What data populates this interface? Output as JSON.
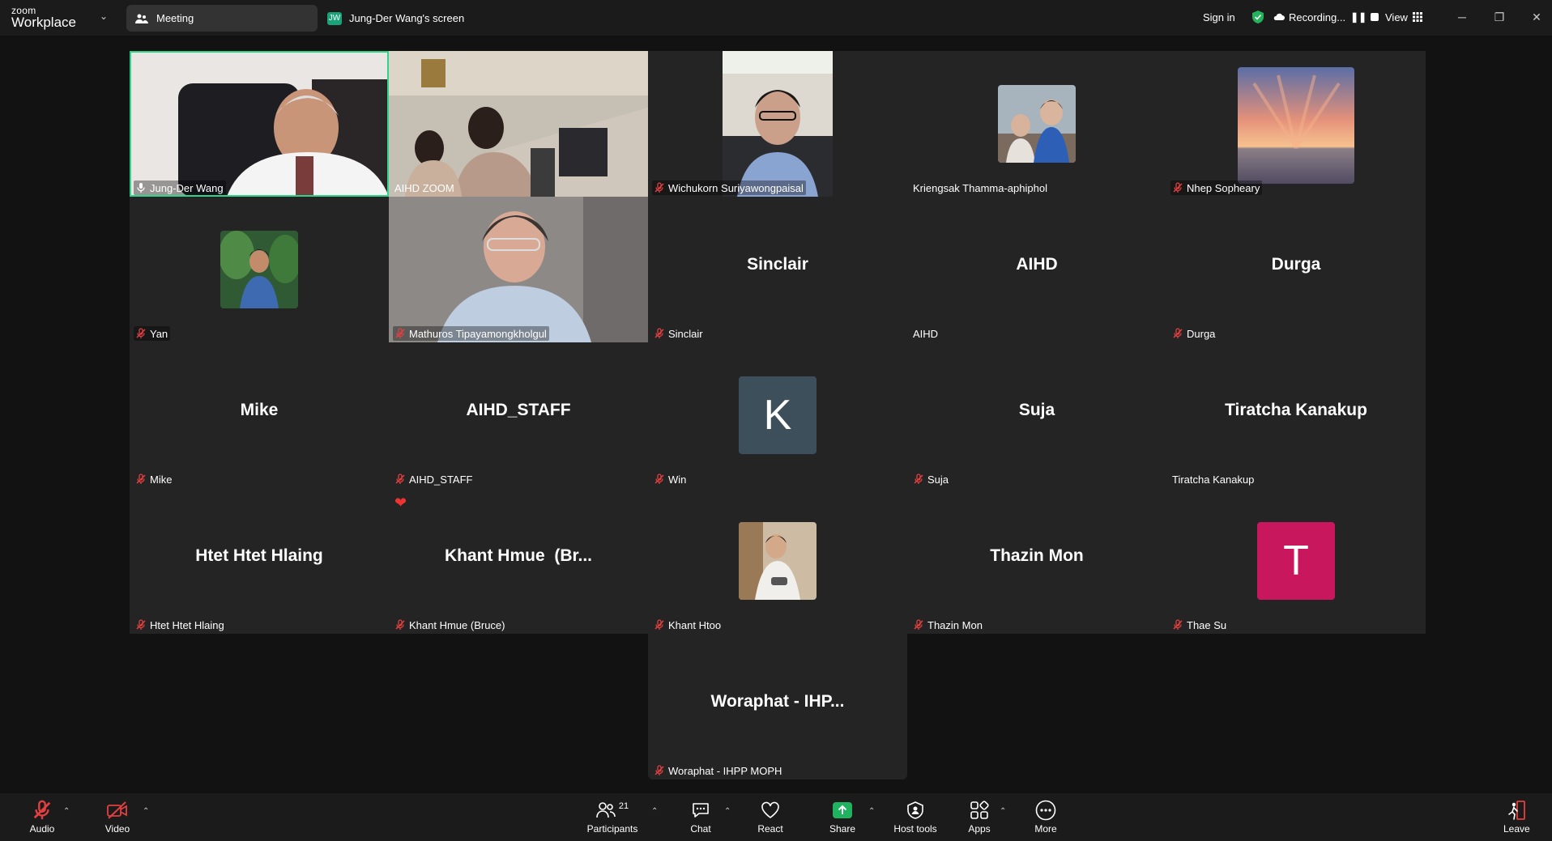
{
  "app": {
    "logo_top": "zoom",
    "logo_bottom": "Workplace"
  },
  "tabs": {
    "meeting": "Meeting",
    "screen_initials": "JW",
    "screen": "Jung-Der Wang's screen"
  },
  "topbar": {
    "sign_in": "Sign in",
    "recording": "Recording...",
    "view": "View"
  },
  "tiles": [
    {
      "label": "Jung-Der Wang",
      "type": "video"
    },
    {
      "label": "AIHD ZOOM",
      "type": "video"
    },
    {
      "label": "Wichukorn Suriyawongpaisal",
      "type": "video"
    },
    {
      "label": "Kriengsak Thamma-aphiphol",
      "type": "photo"
    },
    {
      "label": "Nhep Sopheary",
      "type": "photo"
    },
    {
      "label": "Yan",
      "type": "photo"
    },
    {
      "label": "Mathuros Tipayamongkholgul",
      "type": "video"
    },
    {
      "name": "Sinclair",
      "label": "Sinclair"
    },
    {
      "name": "AIHD",
      "label": "AIHD"
    },
    {
      "name": "Durga",
      "label": "Durga"
    },
    {
      "name": "Mike",
      "label": "Mike"
    },
    {
      "name": "AIHD_STAFF",
      "label": "AIHD_STAFF"
    },
    {
      "avatar": "K",
      "label": "Win"
    },
    {
      "name": "Suja",
      "label": "Suja"
    },
    {
      "name": "Tiratcha Kanakup",
      "label": "Tiratcha Kanakup"
    },
    {
      "name": "Htet Htet Hlaing",
      "label": "Htet Htet Hlaing"
    },
    {
      "name": "Khant Hmue  (Br...",
      "label": "Khant Hmue (Bruce)"
    },
    {
      "label": "Khant Htoo",
      "type": "photo"
    },
    {
      "name": "Thazin Mon",
      "label": "Thazin Mon"
    },
    {
      "avatar": "T",
      "label": "Thae Su"
    },
    {
      "name": "Woraphat - IHP...",
      "label": "Woraphat - IHPP MOPH"
    }
  ],
  "toolbar": {
    "audio": "Audio",
    "video": "Video",
    "participants": "Participants",
    "participants_count": "21",
    "chat": "Chat",
    "react": "React",
    "share": "Share",
    "host_tools": "Host tools",
    "apps": "Apps",
    "more": "More",
    "leave": "Leave"
  },
  "colors": {
    "active_speaker": "#2fd38c",
    "avatar_k": "#3e4f5c",
    "avatar_t": "#c8175d",
    "share": "#1fb35f"
  }
}
